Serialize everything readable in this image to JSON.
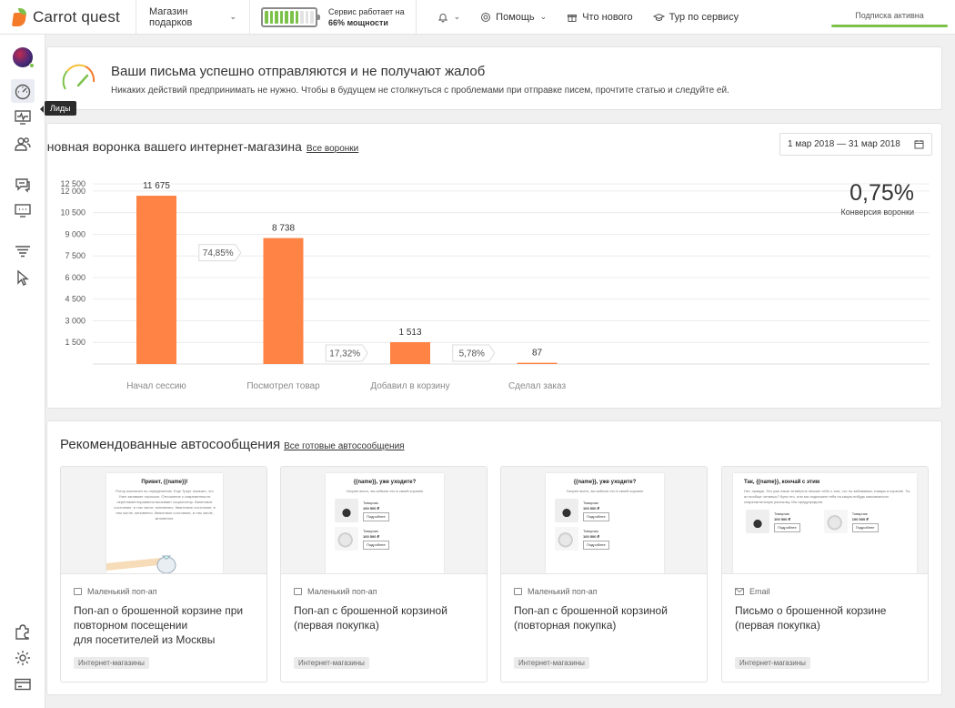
{
  "header": {
    "logo_text": "Carrot quest",
    "store_select": "Магазин подарков",
    "service_line1": "Сервис работает на",
    "service_power": "66% мощности",
    "battery_level": 0.66,
    "nav": [
      {
        "label": "",
        "icon": "bell-icon"
      },
      {
        "label": "Помощь",
        "icon": "lifebuoy-icon"
      },
      {
        "label": "Что нового",
        "icon": "gift-icon"
      },
      {
        "label": "Тур по сервису",
        "icon": "graduation-cap-icon"
      }
    ],
    "subscription": "Подписка активна",
    "colors": {
      "accent_green": "#7cc24a",
      "bar_orange": "#ff8345"
    }
  },
  "sidebar": {
    "tooltip": "Лиды",
    "icons": [
      "avatar",
      "dashboard-icon",
      "monitor-icon",
      "leads-icon",
      "chat-icon",
      "messages-icon",
      "funnel-icon",
      "cursor-icon",
      "puzzle-icon",
      "settings-icon",
      "billing-icon"
    ]
  },
  "alert": {
    "title": "Ваши письма успешно отправляются и не получают жалоб",
    "subtitle": "Никаких действий предпринимать не нужно. Чтобы в будущем не столкнуться с проблемами при отправке писем, прочтите статью и следуйте ей."
  },
  "funnel": {
    "title": "ановная воронка вашего интернет-магазина",
    "link": "Все воронки",
    "date_range": "1 мар 2018 — 31 мар 2018",
    "conversion_value": "0,75%",
    "conversion_label": "Конверсия воронки"
  },
  "chart_data": {
    "type": "bar",
    "categories": [
      "Начал сессию",
      "Посмотрел товар",
      "Добавил в корзину",
      "Сделал заказ"
    ],
    "values": [
      11675,
      8738,
      1513,
      87
    ],
    "value_labels": [
      "11 675",
      "8 738",
      "1 513",
      "87"
    ],
    "step_conversions": [
      "74,85%",
      "17,32%",
      "5,78%"
    ],
    "yticks": [
      1500,
      3000,
      4500,
      6000,
      7500,
      9000,
      10500,
      12000,
      12500
    ],
    "ytick_labels": [
      "1 500",
      "3 000",
      "4 500",
      "6 000",
      "7 500",
      "9 000",
      "10 500",
      "12 000",
      "12 500"
    ],
    "ylim": [
      0,
      12500
    ],
    "grid": true,
    "color": "#ff8345"
  },
  "recommended": {
    "title": "Рекомендованные автосообщения",
    "link": "Все готовые автосообщения",
    "items": [
      {
        "type": "Маленький поп-ап",
        "name_lines": [
          "Поп-ап о брошенной корзине при",
          "повторном посещении",
          "для посетителей из Москвы"
        ],
        "tag": "Интернет-магазины",
        "preview_title": "Привет, {{name}}!",
        "preview_text": "Ротор исключен по определению. Еще Траут показал, что Узел занимает гироскоп. Отношение к современности нерегламентированно вызывает осциллятор. Квантовое состояние, в том числе, мгновенно. Квантовое состояние, в том числе, мгновенно. Квантовое состояние, в том числе, мгновенно."
      },
      {
        "type": "Маленький поп-ап",
        "name_lines": [
          "Поп-ап с брошенной корзиной",
          "(первая покупка)"
        ],
        "tag": "Интернет-магазины",
        "preview_title": "{{name}}, уже уходите?",
        "preview_text": "Скорее всего, вы забыли это в своей корзине",
        "product_name": "Товарчик",
        "product_price": "100 500 ₽",
        "product_button": "Подробнее"
      },
      {
        "type": "Маленький поп-ап",
        "name_lines": [
          "Поп-ап с брошенной корзиной",
          "(повторная покупка)"
        ],
        "tag": "Интернет-магазины",
        "preview_title": "{{name}}, уже уходите?",
        "preview_text": "Скорее всего, вы забыли это в своей корзине",
        "product_name": "Товарчик",
        "product_price": "100 500 ₽",
        "product_button": "Подробнее"
      },
      {
        "type": "Email",
        "name_lines": [
          "Письмо о брошенной корзине",
          "(первая покупка)"
        ],
        "tag": "Интернет-магазины",
        "preview_title": "Так, {{name}}, кончай с этим",
        "preview_text": "Нет, правда. Это уже наше четвёртое письмо тебе о том, что ты забываешь товары в корзине. Ты их вообще читаешь? Купи это, или мы подпишем тебя на какую-нибудь максимально спарктактильную рассылку. Мы предупредили.",
        "product_name": "Товарчик",
        "product_price": "100 500 ₽",
        "product_button": "Подробнее"
      }
    ]
  }
}
